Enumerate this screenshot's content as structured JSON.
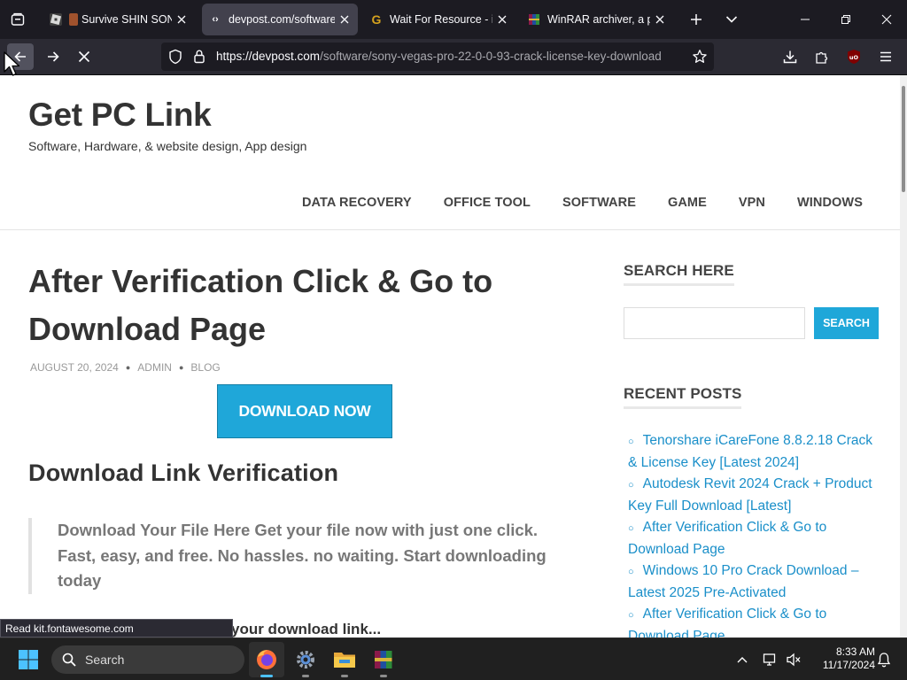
{
  "browser": {
    "tabs": [
      {
        "title": "Survive SHIN SONIC",
        "active": false
      },
      {
        "title": "devpost.com/software/",
        "active": true
      },
      {
        "title": "Wait For Resource - iGe",
        "active": false
      },
      {
        "title": "WinRAR archiver, a pow",
        "active": false
      }
    ],
    "url_host": "https://devpost.com",
    "url_path": "/software/sony-vegas-pro-22-0-0-93-crack-license-key-download",
    "status_text": "Read kit.fontawesome.com"
  },
  "site": {
    "title": "Get PC Link",
    "tagline": "Software, Hardware, & website design, App design",
    "nav": [
      "DATA RECOVERY",
      "OFFICE TOOL",
      "SOFTWARE",
      "GAME",
      "VPN",
      "WINDOWS"
    ]
  },
  "post": {
    "title": "After Verification Click & Go to Download Page",
    "date": "AUGUST 20, 2024",
    "author": "ADMIN",
    "category": "BLOG",
    "download_button": "DOWNLOAD NOW",
    "heading": "Download Link Verification",
    "quote": "Download Your File Here Get your file now with just one click. Fast, easy, and free. No hassles. no waiting. Start downloading today",
    "partial_text": "your download link..."
  },
  "sidebar": {
    "search_heading": "SEARCH HERE",
    "search_placeholder": "",
    "search_button": "SEARCH",
    "recent_heading": "RECENT POSTS",
    "recent_posts": [
      "Tenorshare iCareFone 8.8.2.18 Crack & License Key [Latest 2024]",
      "Autodesk Revit 2024 Crack + Product Key Full Download [Latest]",
      "After Verification Click & Go to Download Page",
      "Windows 10 Pro Crack Download – Latest 2025 Pre-Activated",
      "After Verification Click & Go to Download Page"
    ]
  },
  "taskbar": {
    "search_label": "Search",
    "time": "8:33 AM",
    "date": "11/17/2024"
  },
  "colors": {
    "accent": "#1fa7d9",
    "link": "#1a8fc9",
    "browser_bg": "#1c1b22",
    "taskbar_bg": "#202020"
  }
}
